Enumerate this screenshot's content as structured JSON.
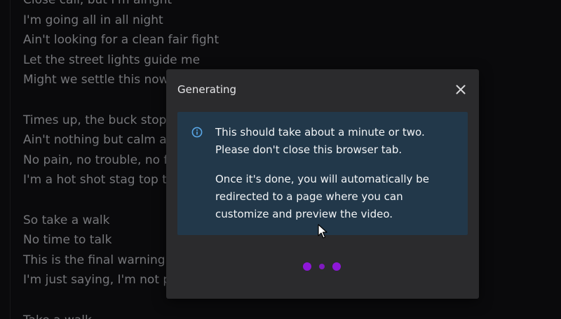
{
  "lyrics": {
    "lines": [
      "Close call, but I'm alright",
      "I'm going all in all night",
      "Ain't looking for a clean fair fight",
      "Let the street lights guide me",
      "Might we settle this now",
      "",
      "Times up, the buck stops",
      "Ain't nothing but calm and",
      "No pain, no trouble, no fe",
      "I'm a hot shot stag top te",
      "",
      "So take a walk",
      "No time to talk",
      "This is the final warning",
      "I'm just saying, I'm not pla",
      "",
      "Take a walk"
    ]
  },
  "modal": {
    "title": "Generating",
    "close_icon": "close-icon",
    "info": {
      "icon": "info-icon",
      "paragraph_1": "This should take about a minute or two. Please don't close this browser tab.",
      "paragraph_2": "Once it's done, you will automatically be redirected to a page where you can customize and preview the video."
    },
    "loader": {
      "icon": "loading-dots",
      "color": "#8e17d8"
    }
  },
  "colors": {
    "background": "#0e0e10",
    "modal_background": "#2b2b2d",
    "info_background": "#22384a",
    "info_icon": "#5aa8e8",
    "lyrics_text": "#9d9ea3"
  }
}
